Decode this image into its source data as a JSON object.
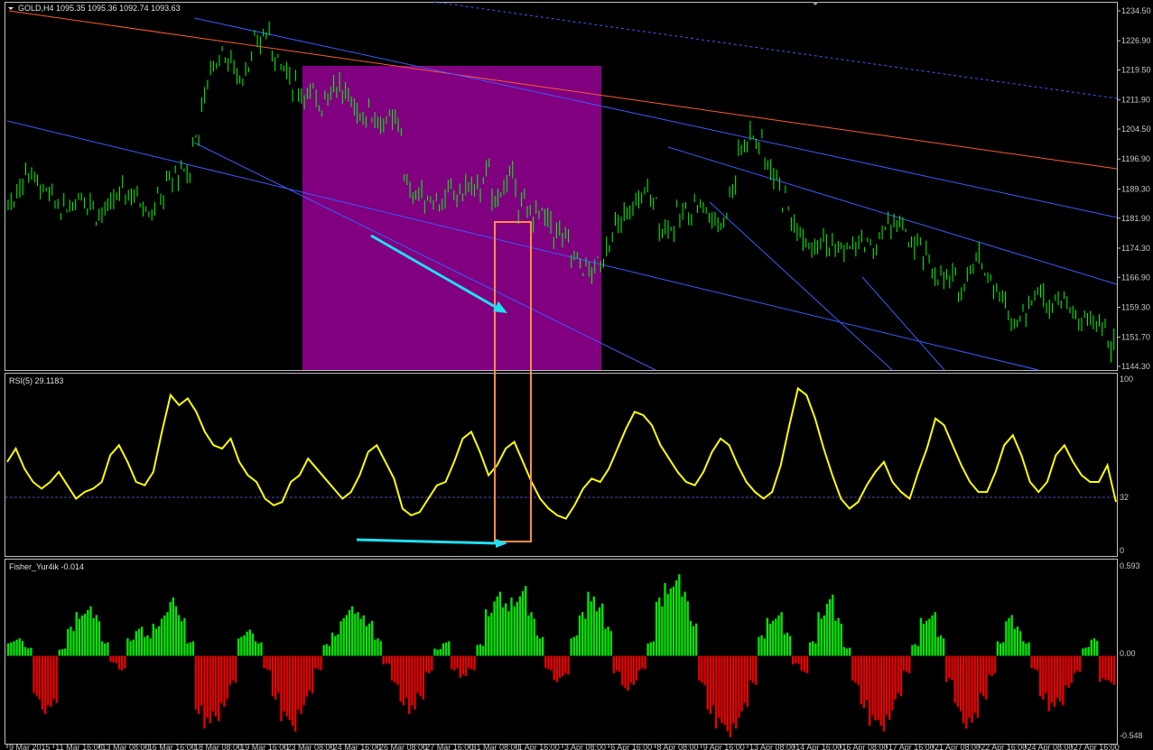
{
  "chart_data": [
    {
      "type": "candlestick",
      "title": "GOLD,H4  1095.35 1095.36 1092.74 1093.63",
      "symbol": "GOLD",
      "timeframe": "H4",
      "ohlc": {
        "open": 1095.35,
        "high": 1095.36,
        "low": 1092.74,
        "close": 1093.63
      },
      "ylim": [
        1144.3,
        1234.5
      ],
      "y_ticks": [
        "1234.50",
        "1226.90",
        "1219.50",
        "1211.90",
        "1204.50",
        "1196.90",
        "1189.30",
        "1181.90",
        "1174.30",
        "1166.90",
        "1159.30",
        "1151.70",
        "1144.30"
      ],
      "series": [
        {
          "values": [
            1186,
            1190,
            1194,
            1191,
            1188,
            1186,
            1184,
            1186,
            1188,
            1186,
            1183,
            1184,
            1187,
            1189,
            1188,
            1186,
            1184,
            1187,
            1191,
            1193,
            1193,
            1202,
            1213,
            1221,
            1224,
            1221,
            1218,
            1221,
            1226,
            1229,
            1224,
            1220,
            1216,
            1214,
            1213,
            1211,
            1214,
            1216,
            1213,
            1210,
            1208,
            1209,
            1206,
            1206,
            1206,
            1190,
            1188,
            1187,
            1187,
            1186,
            1188,
            1188,
            1190,
            1189,
            1193,
            1187,
            1190,
            1192,
            1185,
            1183,
            1183,
            1181,
            1178,
            1176,
            1172,
            1170,
            1168,
            1171,
            1176,
            1180,
            1182,
            1186,
            1189,
            1186,
            1180,
            1180,
            1182,
            1184,
            1186,
            1184,
            1181,
            1182,
            1190,
            1200,
            1203,
            1201,
            1196,
            1192,
            1186,
            1180,
            1178,
            1176,
            1177,
            1175,
            1174,
            1174,
            1175,
            1176,
            1174,
            1178,
            1181,
            1180,
            1176,
            1174,
            1172,
            1168,
            1166,
            1166,
            1164,
            1170,
            1172,
            1168,
            1163,
            1160,
            1156,
            1158,
            1162,
            1163,
            1161,
            1162,
            1160,
            1157,
            1156,
            1155,
            1155,
            1149
          ]
        }
      ],
      "trend_lines": true,
      "highlight_zone": "purple rectangle",
      "markers": [
        "orange box",
        "cyan arrow"
      ],
      "colors": {
        "candle": "#00ff00",
        "zone": "#800080",
        "box": "#ff8c4a",
        "arrow": "#1ee0f0",
        "line_red": "#ff5a2e",
        "line_blue": "#3a5bff"
      }
    },
    {
      "type": "line",
      "title": "RSI(5) 29.1183",
      "indicator": "RSI(5)",
      "value": 29.1183,
      "ylim": [
        0,
        100
      ],
      "y_ticks": [
        "100",
        "32",
        "0"
      ],
      "level": 32,
      "series": [
        {
          "values": [
            52,
            60,
            48,
            40,
            36,
            40,
            46,
            38,
            30,
            34,
            36,
            40,
            56,
            62,
            52,
            40,
            38,
            46,
            70,
            92,
            86,
            90,
            82,
            70,
            62,
            60,
            66,
            52,
            44,
            40,
            30,
            26,
            28,
            40,
            44,
            54,
            48,
            42,
            36,
            30,
            34,
            44,
            58,
            62,
            52,
            42,
            24,
            20,
            22,
            30,
            38,
            40,
            52,
            66,
            70,
            58,
            44,
            50,
            60,
            64,
            52,
            40,
            30,
            24,
            20,
            18,
            26,
            36,
            42,
            40,
            48,
            60,
            72,
            82,
            80,
            74,
            62,
            54,
            46,
            40,
            38,
            46,
            58,
            66,
            62,
            50,
            40,
            34,
            30,
            34,
            50,
            74,
            96,
            92,
            78,
            60,
            44,
            30,
            24,
            28,
            38,
            46,
            52,
            40,
            34,
            30,
            46,
            60,
            78,
            74,
            62,
            50,
            40,
            34,
            34,
            46,
            62,
            68,
            56,
            40,
            34,
            40,
            56,
            62,
            52,
            44,
            40,
            40,
            50,
            28
          ]
        }
      ],
      "colors": {
        "line": "#ffff00",
        "level": "#4a4aaa"
      }
    },
    {
      "type": "bar",
      "title": "Fisher_Yur4ik -0.014",
      "indicator": "Fisher_Yur4ik",
      "value": -0.014,
      "ylim": [
        -0.548,
        0.593
      ],
      "y_ticks": [
        "0.593",
        "0.00",
        "-0.548"
      ],
      "series": [
        {
          "values": [
            0.1,
            0.12,
            0.06,
            -0.3,
            -0.4,
            -0.35,
            0.05,
            0.2,
            0.3,
            0.34,
            0.28,
            0.1,
            -0.05,
            -0.1,
            0.12,
            0.2,
            0.14,
            0.22,
            0.3,
            0.4,
            0.28,
            0.1,
            -0.4,
            -0.5,
            -0.45,
            -0.35,
            -0.2,
            0.14,
            0.18,
            0.1,
            -0.1,
            -0.3,
            -0.45,
            -0.52,
            -0.4,
            -0.28,
            -0.1,
            0.08,
            0.16,
            0.28,
            0.34,
            0.3,
            0.24,
            0.12,
            -0.06,
            -0.2,
            -0.34,
            -0.4,
            -0.3,
            -0.12,
            0.05,
            0.1,
            -0.1,
            -0.15,
            -0.1,
            0.08,
            0.32,
            0.44,
            0.36,
            0.4,
            0.48,
            0.3,
            0.14,
            -0.1,
            -0.18,
            -0.14,
            0.14,
            0.3,
            0.44,
            0.36,
            0.2,
            -0.12,
            -0.24,
            -0.2,
            -0.1,
            0.1,
            0.4,
            0.5,
            0.56,
            0.44,
            0.24,
            -0.2,
            -0.4,
            -0.5,
            -0.56,
            -0.5,
            -0.38,
            -0.2,
            0.14,
            0.26,
            0.3,
            0.16,
            -0.06,
            -0.12,
            0.1,
            0.3,
            0.42,
            0.26,
            0.06,
            -0.2,
            -0.36,
            -0.48,
            -0.52,
            -0.44,
            -0.3,
            -0.12,
            0.08,
            0.26,
            0.3,
            0.14,
            -0.18,
            -0.38,
            -0.5,
            -0.46,
            -0.3,
            -0.14,
            0.1,
            0.28,
            0.2,
            0.1,
            -0.1,
            -0.3,
            -0.38,
            -0.34,
            -0.22,
            -0.12,
            0.06,
            0.12,
            -0.18,
            -0.2
          ]
        }
      ],
      "colors": {
        "positive": "#00e800",
        "negative": "#e80000"
      }
    }
  ],
  "x_axis_labels": [
    "9 Mar 2015",
    "11 Mar 16:00",
    "13 Mar 08:00",
    "16 Mar 16:00",
    "18 Mar 08:00",
    "19 Mar 16:00",
    "23 Mar 08:00",
    "24 Mar 16:00",
    "26 Mar 08:00",
    "27 Mar 16:00",
    "31 Mar 08:00",
    "1 Apr 16:00",
    "3 Apr 08:00",
    "6 Apr 16:00",
    "8 Apr 08:00",
    "9 Apr 16:00",
    "13 Apr 08:00",
    "14 Apr 16:00",
    "16 Apr 08:00",
    "17 Apr 16:00",
    "21 Apr 08:00",
    "22 Apr 16:00",
    "24 Apr 08:00",
    "27 Apr 16:00"
  ]
}
